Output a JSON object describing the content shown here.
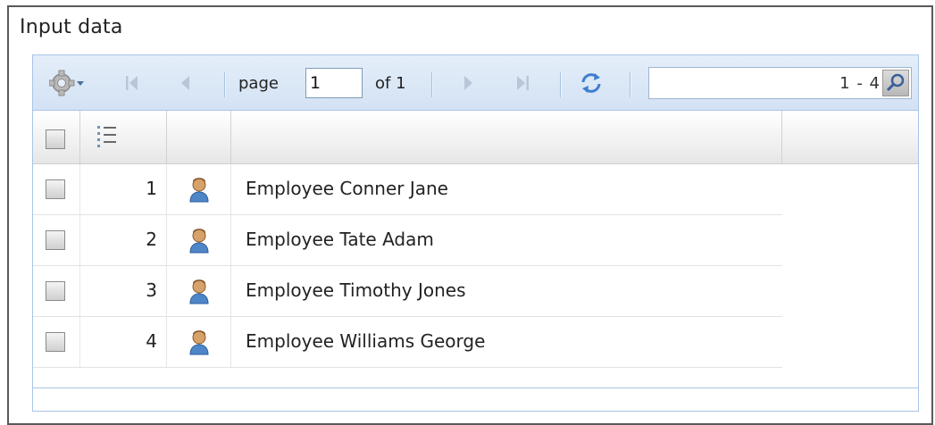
{
  "panel": {
    "title": "Input data"
  },
  "toolbar": {
    "settings_icon": "gear-icon",
    "first_icon": "first-page-icon",
    "prev_icon": "prev-page-icon",
    "page_label": "page",
    "page_value": "1",
    "of_label": "of 1",
    "next_icon": "next-page-icon",
    "last_icon": "last-page-icon",
    "refresh_icon": "refresh-icon",
    "search_value": "",
    "range_text": "1 - 4",
    "search_icon": "search-icon"
  },
  "grid": {
    "header": {
      "sort_icon": "numbered-list-icon"
    },
    "rows": [
      {
        "num": "1",
        "name": "Employee Conner Jane",
        "icon": "user-icon"
      },
      {
        "num": "2",
        "name": "Employee Tate Adam",
        "icon": "user-icon"
      },
      {
        "num": "3",
        "name": "Employee Timothy Jones",
        "icon": "user-icon"
      },
      {
        "num": "4",
        "name": "Employee Williams George",
        "icon": "user-icon"
      }
    ]
  },
  "colors": {
    "toolbar_bg": "#d3e2f4",
    "border_blue": "#a9c4e6",
    "user_icon_blue": "#4f86c8",
    "user_icon_skin": "#d6a26a"
  }
}
